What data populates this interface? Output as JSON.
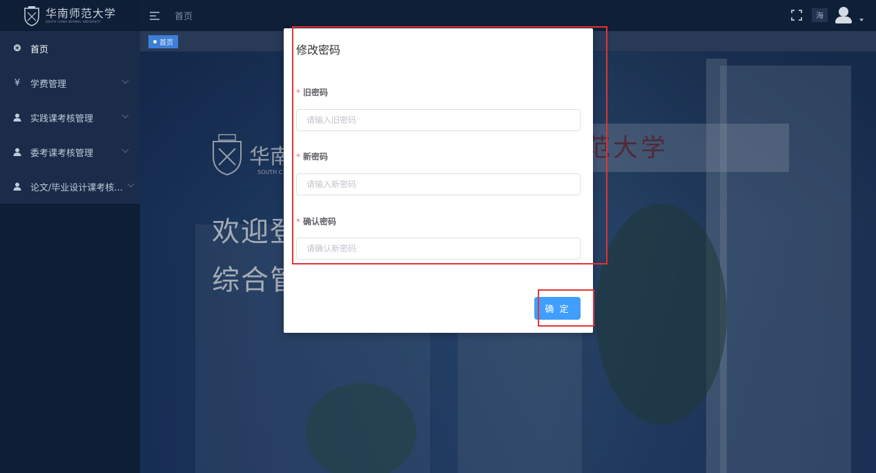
{
  "sidebar": {
    "logo_cn": "华南师范大学",
    "logo_en": "SOUTH CHINA NORMAL UNIVERSITY",
    "items": [
      {
        "label": "首页",
        "icon": "dashboard-icon",
        "glyph": "❂"
      },
      {
        "label": "学费管理",
        "icon": "yen-icon",
        "glyph": "¥"
      },
      {
        "label": "实践课考核管理",
        "icon": "user-icon",
        "glyph": "●"
      },
      {
        "label": "委考课考核管理",
        "icon": "user-icon",
        "glyph": "●"
      },
      {
        "label": "论文/毕业设计课考核...",
        "icon": "user-icon",
        "glyph": "●"
      }
    ]
  },
  "header": {
    "title": "首页",
    "user_name": "海"
  },
  "tags": {
    "active": "首页"
  },
  "background": {
    "gate_text": "范大学",
    "logo_text": "华南",
    "logo_en": "SOUTH C",
    "welcome_line1": "欢迎登",
    "welcome_line2": "综合管"
  },
  "dialog": {
    "title": "修改密码",
    "old_password": {
      "label": "旧密码",
      "placeholder": "请输入旧密码",
      "value": ""
    },
    "new_password": {
      "label": "新密码",
      "placeholder": "请输入新密码",
      "value": ""
    },
    "confirm_password": {
      "label": "确认密码",
      "placeholder": "请确认新密码",
      "value": ""
    },
    "confirm_button": "确 定",
    "required_mark": "*"
  },
  "colors": {
    "primary": "#409eff",
    "required": "#f56c6c",
    "annotation": "#e33333",
    "sidebar_bg": "#0e1e37"
  }
}
